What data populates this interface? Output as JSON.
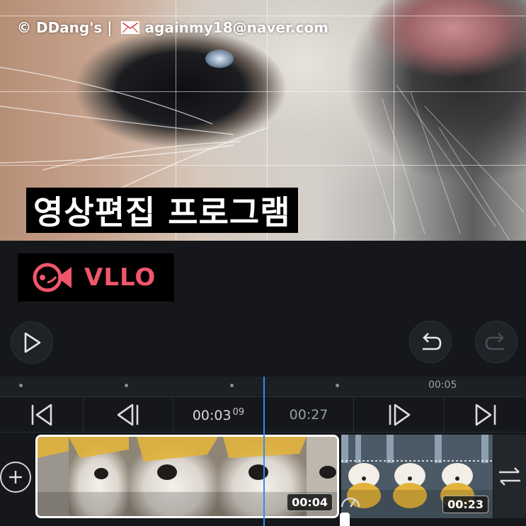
{
  "preview": {
    "watermark": {
      "author": "© DDang's |",
      "email": "againmy18@naver.com",
      "mail_icon": "envelope-icon"
    },
    "title_banner": "영상편집 프로그램"
  },
  "logo": {
    "text": "VLLO",
    "icon": "fish-icon",
    "color": "#f0566a"
  },
  "controls": {
    "play_icon": "play-icon",
    "undo_icon": "undo-icon",
    "redo_icon": "redo-icon",
    "redo_enabled": false
  },
  "ruler": {
    "label": "00:05"
  },
  "transport": {
    "current_time": "00:03",
    "current_frames": "09",
    "total_duration": "00:27",
    "buttons": [
      "skip-to-start-icon",
      "prev-frame-icon",
      "next-frame-icon",
      "skip-to-end-icon"
    ]
  },
  "timeline": {
    "clips": [
      {
        "duration": "00:04",
        "selected": true
      },
      {
        "duration": "00:23",
        "selected": false
      }
    ],
    "add_icon": "add-clip-icon",
    "swap_icon": "swap-icon",
    "speed_icon": "speed-icon",
    "accent": "#2f8df5"
  }
}
